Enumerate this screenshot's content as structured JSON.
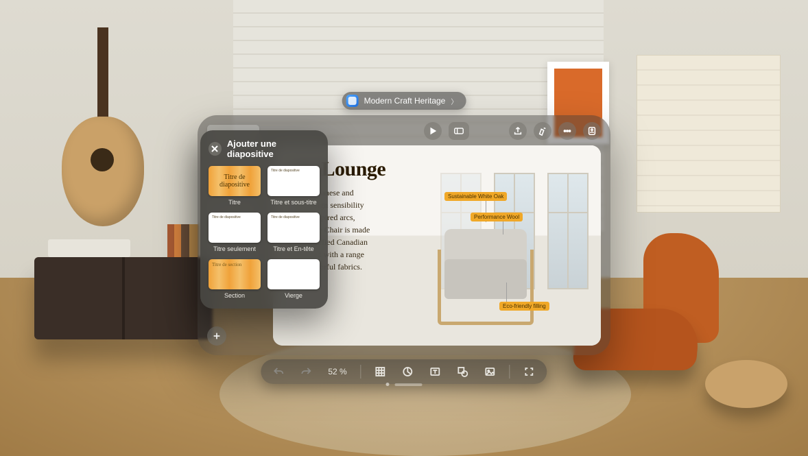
{
  "document_title": "Modern Craft Heritage",
  "toolbar": {
    "play": "Play",
    "present": "Present",
    "share": "Share",
    "format": "Format",
    "more": "More",
    "collab": "Collaborate"
  },
  "slide": {
    "title_visible": "con Lounge",
    "body_visible": "from a Japanese and\navian design sensibility\nnically inspired arcs,\non Lounge Chair is made\nnably certified Canadian\narmonized with a range\nes and colorful fabrics.",
    "labels": {
      "oak": "Sustainable White Oak",
      "wool": "Performance Wool",
      "fill": "Eco-friendly filling"
    }
  },
  "bottom": {
    "zoom": "52 %"
  },
  "popover": {
    "title": "Ajouter une diapositive",
    "items": [
      {
        "label": "Titre",
        "thumb_text": "Titre de diapositive",
        "style": "gradient-big"
      },
      {
        "label": "Titre et sous-titre",
        "thumb_text": "Titre de diapositive",
        "style": "white-small"
      },
      {
        "label": "Titre seulement",
        "thumb_text": "Titre de diapositive",
        "style": "white-small"
      },
      {
        "label": "Titre et En-tête",
        "thumb_text": "Titre de diapositive",
        "style": "white-small"
      },
      {
        "label": "Section",
        "thumb_text": "Titre de section",
        "style": "gradient-left"
      },
      {
        "label": "Vierge",
        "thumb_text": "",
        "style": "white-blank"
      }
    ]
  }
}
